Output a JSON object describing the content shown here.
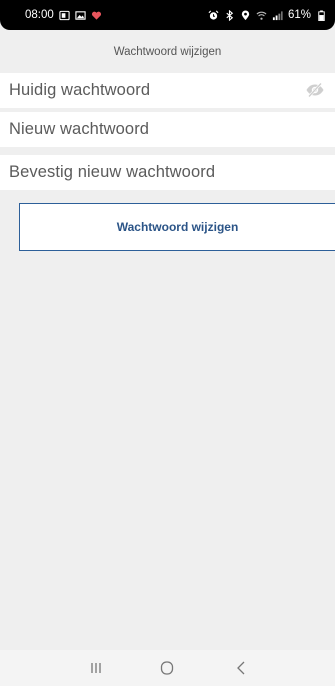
{
  "status_bar": {
    "time": "08:00",
    "battery": "61%",
    "icons_left": [
      "screen-mirror-icon",
      "image-icon",
      "heart-icon"
    ],
    "icons_right": [
      "alarm-icon",
      "bluetooth-icon",
      "location-icon",
      "wifi-icon",
      "signal-icon",
      "battery-icon"
    ]
  },
  "header": {
    "title": "Wachtwoord wijzigen"
  },
  "form": {
    "current_password_placeholder": "Huidig wachtwoord",
    "new_password_placeholder": "Nieuw wachtwoord",
    "confirm_password_placeholder": "Bevestig nieuw wachtwoord",
    "visibility_icon": "eye-hidden-icon"
  },
  "actions": {
    "submit_label": "Wachtwoord wijzigen"
  },
  "nav_bar": {
    "icons": [
      "recents-icon",
      "home-icon",
      "back-icon"
    ]
  },
  "colors": {
    "accent": "#2b5487",
    "background": "#efefef",
    "field_background": "#ffffff"
  }
}
